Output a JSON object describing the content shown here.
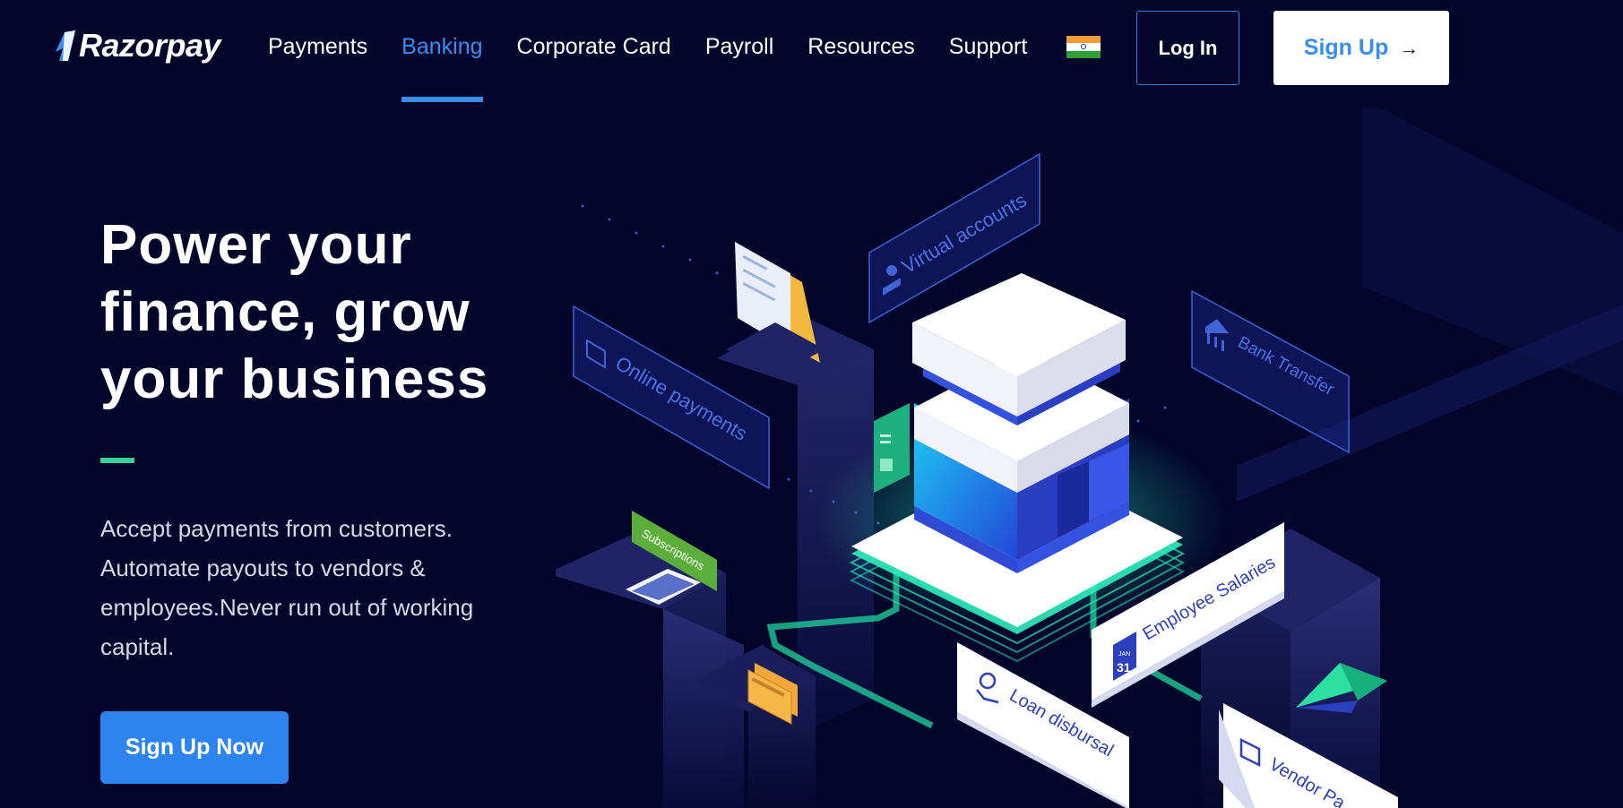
{
  "brand": {
    "name": "Razorpay"
  },
  "nav": {
    "items": [
      {
        "label": "Payments"
      },
      {
        "label": "Banking"
      },
      {
        "label": "Corporate Card"
      },
      {
        "label": "Payroll"
      },
      {
        "label": "Resources"
      },
      {
        "label": "Support"
      }
    ],
    "active": "Banking",
    "country_icon": "india-flag-icon"
  },
  "header": {
    "login_label": "Log In",
    "signup_label": "Sign Up",
    "signup_icon": "arrow-right-icon"
  },
  "hero": {
    "title_line1": "Power your",
    "title_line2": "finance, grow",
    "title_line3": "your business",
    "description_line1": "Accept payments from customers.",
    "description_line2": "Automate payouts to vendors &",
    "description_line3": "employees.Never run out of working",
    "description_line4": "capital.",
    "cta_label": "Sign Up Now"
  },
  "illustration": {
    "labels": {
      "virtual_accounts": "Virtual accounts",
      "online_payments": "Online payments",
      "bank_transfer": "Bank Transfer",
      "subscriptions": "Subscriptions",
      "employee_salaries": "Employee Salaries",
      "loan_disbursal": "Loan disbursal",
      "vendor_payments": "Vendor Pa",
      "calendar_day": "31",
      "calendar_month": "JAN"
    }
  },
  "colors": {
    "background": "#03052b",
    "accent": "#3a8df0",
    "cta": "#2d84ef",
    "divider": "#37d29a",
    "glow": "#23f0b0"
  }
}
